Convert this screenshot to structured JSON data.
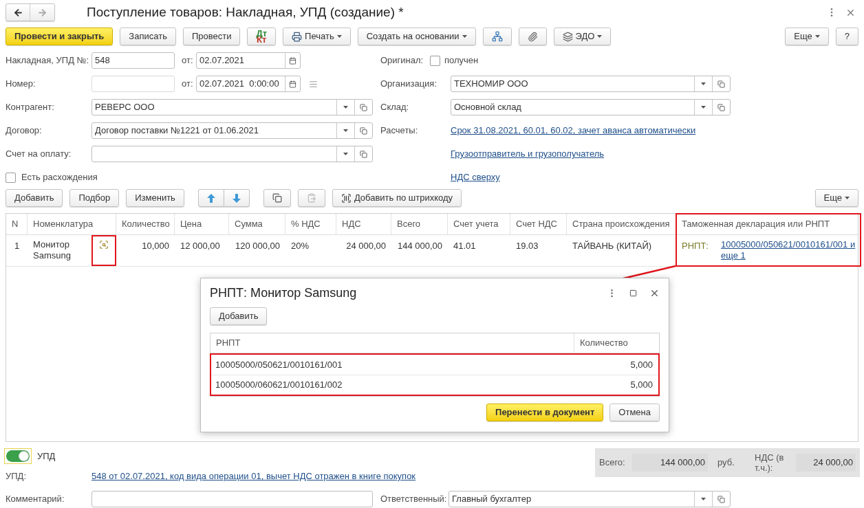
{
  "window": {
    "title": "Поступление товаров: Накладная, УПД (создание) *"
  },
  "toolbar": [
    {
      "kind": "primary",
      "label": "Провести и закрыть"
    },
    {
      "kind": "text",
      "label": "Записать"
    },
    {
      "kind": "text",
      "label": "Провести"
    },
    {
      "kind": "dtkt",
      "top": "Дт",
      "bottom": "Кт"
    },
    {
      "kind": "print_menu",
      "label": "Печать"
    },
    {
      "kind": "menu",
      "label": "Создать на основании"
    },
    {
      "kind": "structure"
    },
    {
      "kind": "clip"
    },
    {
      "kind": "edo_menu",
      "label": "ЭДО"
    }
  ],
  "toolbar_right": [
    {
      "kind": "menu",
      "label": "Еще"
    },
    {
      "kind": "text",
      "label": "?"
    }
  ],
  "form_rows": [
    {
      "left": {
        "kind": "input",
        "label": "Накладная, УПД №:",
        "value": "548",
        "disabled": false,
        "date_label": "от:",
        "date": "02.07.2021",
        "note": false
      },
      "right": {
        "kind": "checkbox",
        "label": "Оригинал:",
        "text": "получен",
        "checked": false
      }
    },
    {
      "left": {
        "kind": "input",
        "label": "Номер:",
        "disabled": true,
        "date_label": "от:",
        "date": "02.07.2021  0:00:00",
        "note": true
      },
      "right": {
        "kind": "select",
        "label": "Организация:",
        "value": "ТЕХНОМИР ООО"
      }
    },
    {
      "left": {
        "kind": "select",
        "label": "Контрагент:",
        "value": "РЕВЕРС ООО"
      },
      "right": {
        "kind": "select",
        "label": "Склад:",
        "value": "Основной склад"
      }
    },
    {
      "left": {
        "kind": "select",
        "label": "Договор:",
        "value": "Договор поставки №1221 от 01.06.2021"
      },
      "right": {
        "kind": "link",
        "label": "Расчеты:",
        "text": "Срок 31.08.2021, 60.01, 60.02, зачет аванса автоматически"
      }
    },
    {
      "left": {
        "kind": "select",
        "label": "Счет на оплату:"
      },
      "right": {
        "kind": "link",
        "text": "Грузоотправитель и грузополучатель"
      }
    },
    {
      "left": {
        "kind": "checkbox",
        "text": "Есть расхождения",
        "checked": false
      },
      "right": {
        "kind": "link",
        "text": "НДС сверху"
      }
    }
  ],
  "table_toolbar": [
    {
      "kind": "text",
      "label": "Добавить"
    },
    {
      "kind": "text",
      "label": "Подбор"
    },
    {
      "kind": "text",
      "label": "Изменить"
    },
    {
      "kind": "updown"
    },
    {
      "kind": "copy"
    },
    {
      "kind": "paste",
      "disabled": true
    },
    {
      "kind": "barcode",
      "label": "Добавить по штрихкоду"
    }
  ],
  "table_toolbar_right": {
    "label": "Еще"
  },
  "table": {
    "columns": [
      {
        "label": "N"
      },
      {
        "label": "Номенклатура"
      },
      {
        "label": "Количество"
      },
      {
        "label": "Цена"
      },
      {
        "label": "Сумма"
      },
      {
        "label": "% НДС"
      },
      {
        "label": "НДС"
      },
      {
        "label": "Всего"
      },
      {
        "label": "Счет учета"
      },
      {
        "label": "Счет НДС"
      },
      {
        "label": "Страна происхождения"
      },
      {
        "label": "Таможенная декларация или РНПТ",
        "highlighted": true
      }
    ],
    "rows": [
      {
        "icon_highlighted": true,
        "cells": [
          "1",
          "Монитор Samsung",
          "10,000",
          "12 000,00",
          "120 000,00",
          "20%",
          "24 000,00",
          "144 000,00",
          "41.01",
          "19.03",
          "ТАЙВАНЬ (КИТАЙ)"
        ],
        "customs": {
          "prefix": "РНПТ:",
          "link": "10005000/050621/0010161/001 и еще 1"
        }
      }
    ]
  },
  "dialog": {
    "title": "РНПТ: Монитор Samsung",
    "add_button": "Добавить",
    "columns": [
      "РНПТ",
      "Количество"
    ],
    "rows_highlighted": true,
    "rows": [
      {
        "rnpt": "10005000/050621/0010161/001",
        "qty": "5,000"
      },
      {
        "rnpt": "10005000/060621/0010161/002",
        "qty": "5,000"
      }
    ],
    "buttons": [
      {
        "kind": "primary",
        "label": "Перенести в документ"
      },
      {
        "kind": "text",
        "label": "Отмена"
      }
    ]
  },
  "upd_toggle": {
    "label": "УПД",
    "on": true
  },
  "upd": {
    "label": "УПД:",
    "link": "548 от 02.07.2021, код вида операции 01, вычет НДС отражен в книге покупок"
  },
  "totals": {
    "total_label": "Всего:",
    "total": "144 000,00",
    "currency": "руб.",
    "vat_label": "НДС (в т.ч.):",
    "vat": "24 000,00"
  },
  "comment": {
    "label": "Комментарий:"
  },
  "responsible": {
    "label": "Ответственный:",
    "value": "Главный бухгалтер"
  }
}
